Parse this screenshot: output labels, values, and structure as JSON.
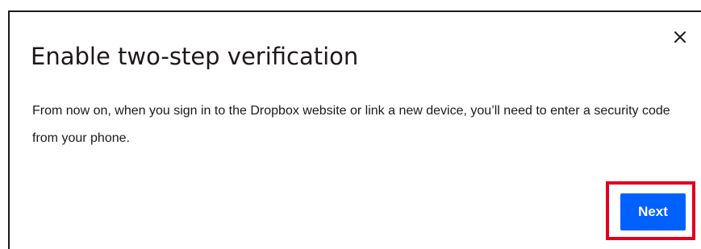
{
  "dialog": {
    "title": "Enable two-step verification",
    "description": "From now on, when you sign in to the Dropbox website or link a new device, you’ll need to enter a security code from your phone.",
    "close_icon": "close-icon",
    "next_label": "Next"
  },
  "colors": {
    "primary_button": "#0061fe",
    "text": "#1e1919",
    "highlight": "#e0001b"
  }
}
